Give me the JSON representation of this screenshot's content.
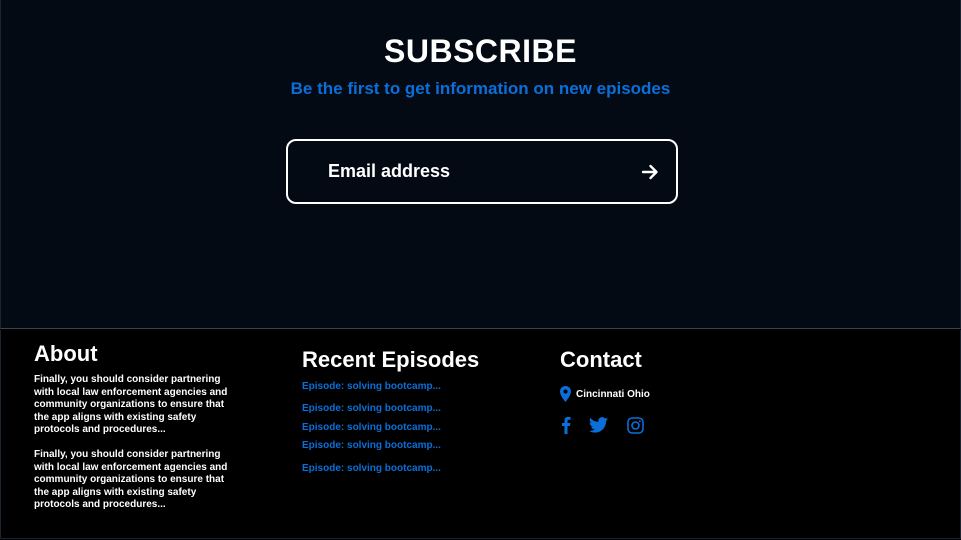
{
  "subscribe": {
    "title": "SUBSCRIBE",
    "subtitle": "Be the first to get information on new episodes",
    "email_placeholder": "Email address"
  },
  "footer": {
    "about": {
      "heading": "About",
      "paragraphs": [
        "Finally, you should consider partnering with local law enforcement agencies and community organizations to ensure that the app aligns with existing safety protocols and procedures...",
        "Finally, you should consider partnering with local law enforcement agencies and community organizations to ensure that the app aligns with existing safety protocols and procedures..."
      ]
    },
    "recent": {
      "heading": "Recent Episodes",
      "episodes": [
        "Episode: solving bootcamp...",
        "Episode: solving bootcamp...",
        "Episode: solving bootcamp...",
        "Episode: solving bootcamp...",
        "Episode: solving bootcamp..."
      ]
    },
    "contact": {
      "heading": "Contact",
      "location": "Cincinnati Ohio",
      "location_icon": "map-pin-icon",
      "social_icons": [
        "facebook-icon",
        "twitter-icon",
        "instagram-icon"
      ]
    }
  },
  "colors": {
    "accent": "#0a6fd8",
    "subscribe_bg": "#030a14",
    "footer_bg": "#000000",
    "text": "#ffffff"
  }
}
